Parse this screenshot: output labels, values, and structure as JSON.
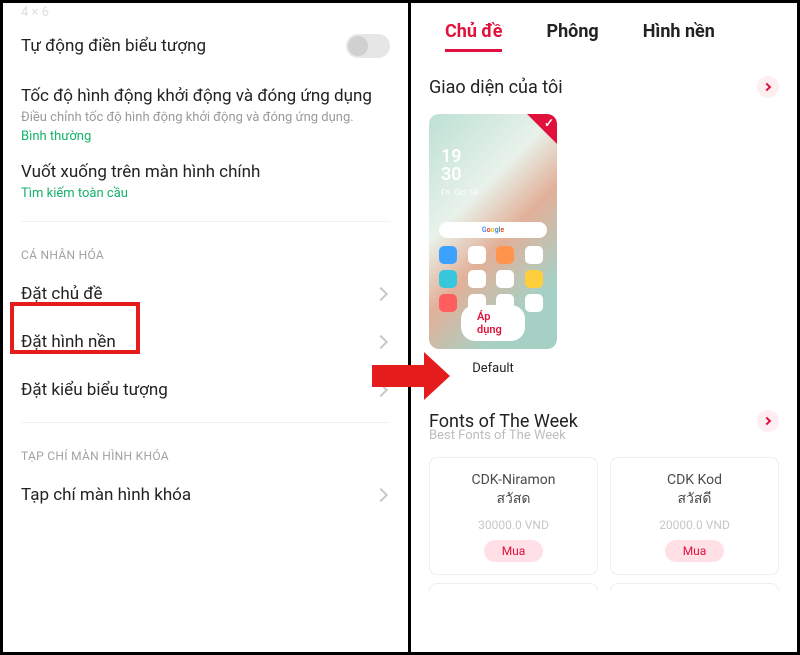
{
  "left": {
    "gridLabel": "4 × 6",
    "autoFill": {
      "title": "Tự động điền biểu tượng"
    },
    "animSpeed": {
      "title": "Tốc độ hình động khởi động và đóng ứng dụng",
      "sub": "Điều chỉnh tốc độ hình động khởi động và đóng ứng dụng.",
      "value": "Bình thường"
    },
    "swipeDown": {
      "title": "Vuốt xuống trên màn hình chính",
      "value": "Tìm kiếm toàn cầu"
    },
    "personalization": {
      "header": "CÁ NHÂN HÓA",
      "items": [
        "Đặt chủ đề",
        "Đặt hình nền",
        "Đặt kiểu biểu tượng"
      ]
    },
    "lockMag": {
      "header": "TẠP CHÍ MÀN HÌNH KHÓA",
      "item": "Tạp chí màn hình khóa"
    }
  },
  "right": {
    "tabs": {
      "theme": "Chủ đề",
      "font": "Phông",
      "wallpaper": "Hình nền"
    },
    "myUi": {
      "title": "Giao diện của tôi",
      "preview": {
        "time": "19",
        "time2": "30",
        "day": "Fri. Oct 14",
        "applyLabel": "Áp dụng"
      },
      "name": "Default"
    },
    "fontsWeek": {
      "title": "Fonts of The Week",
      "sub": "Best Fonts of The Week",
      "cards": [
        {
          "line1": "CDK-Niramon",
          "line2": "สวัสด",
          "price": "30000.0 VND",
          "buy": "Mua"
        },
        {
          "line1": "CDK Kod",
          "line2": "สวัสดี",
          "price": "20000.0 VND",
          "buy": "Mua"
        }
      ]
    }
  }
}
